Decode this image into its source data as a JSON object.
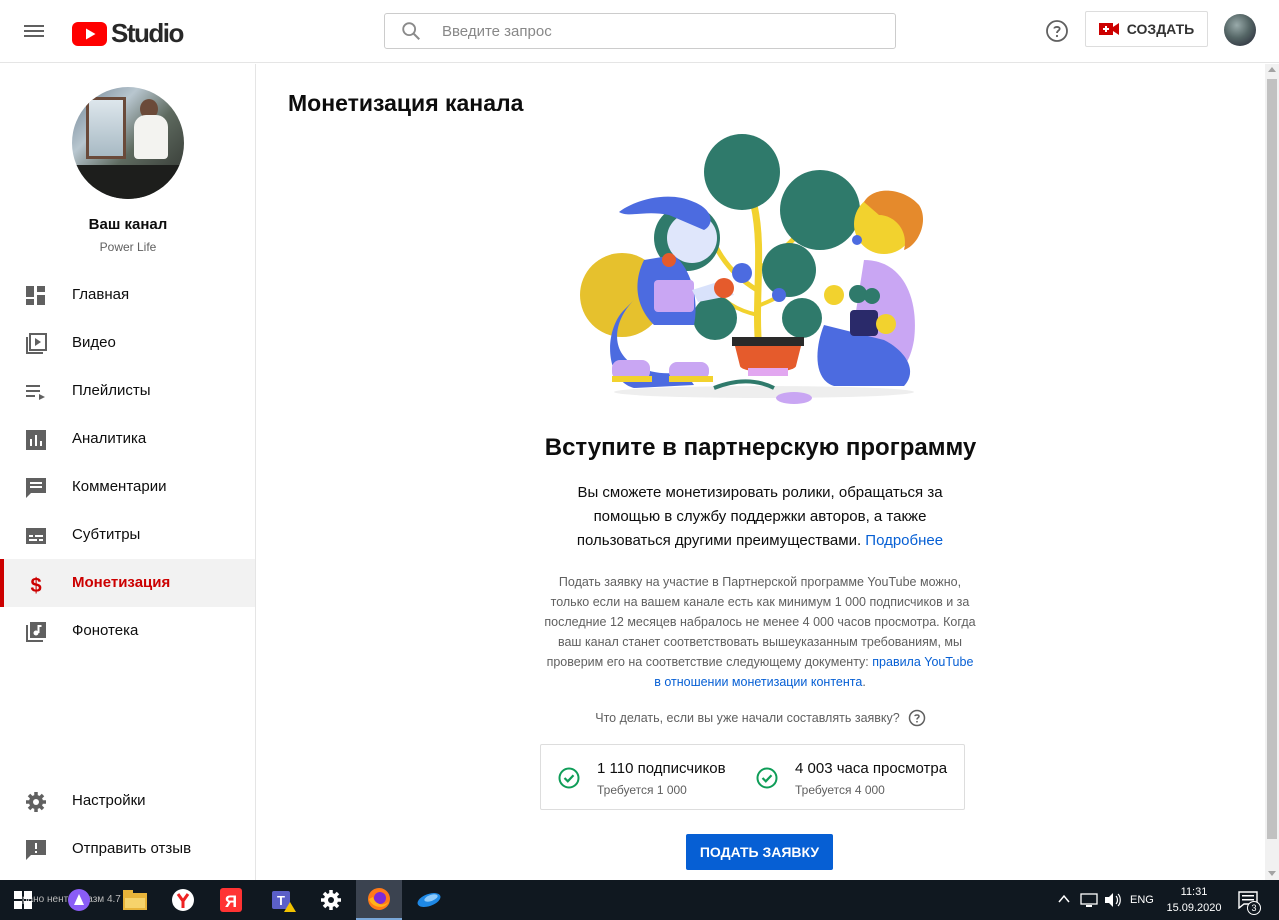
{
  "header": {
    "studio_label": "Studio",
    "search_placeholder": "Введите запрос",
    "create_label": "СОЗДАТЬ"
  },
  "sidebar": {
    "channel_name": "Ваш канал",
    "channel_handle": "Power Life",
    "items": [
      {
        "label": "Главная",
        "icon": "dashboard-icon"
      },
      {
        "label": "Видео",
        "icon": "video-library-icon"
      },
      {
        "label": "Плейлисты",
        "icon": "playlist-icon"
      },
      {
        "label": "Аналитика",
        "icon": "analytics-icon"
      },
      {
        "label": "Комментарии",
        "icon": "comment-icon"
      },
      {
        "label": "Субтитры",
        "icon": "subtitles-icon"
      },
      {
        "label": "Монетизация",
        "icon": "dollar-icon",
        "active": true
      },
      {
        "label": "Фонотека",
        "icon": "music-library-icon"
      }
    ],
    "bottom_items": [
      {
        "label": "Настройки",
        "icon": "settings-icon"
      },
      {
        "label": "Отправить отзыв",
        "icon": "feedback-icon"
      }
    ]
  },
  "main": {
    "page_title": "Монетизация канала",
    "heading": "Вступите в партнерскую программу",
    "intro_text": "Вы сможете монетизировать ролики, обращаться за помощью в службу поддержки авторов, а также пользоваться другими преимуществами.",
    "intro_link": "Подробнее",
    "requirements_text": "Подать заявку на участие в Партнерской программе YouTube можно, только если на вашем канале есть как минимум 1 000 подписчиков и за последние 12 месяцев набралось не менее 4 000 часов просмотра. Когда ваш канал станет соответствовать вышеуказанным требованиям, мы проверим его на соответствие следующему документу:",
    "requirements_link": "правила YouTube в отношении монетизации контента",
    "requirements_end": ".",
    "faq_text": "Что делать, если вы уже начали составлять заявку?",
    "stats": [
      {
        "value": "1 110 подписчиков",
        "required": "Требуется 1 000"
      },
      {
        "value": "4 003 часа просмотра",
        "required": "Требуется 4 000"
      }
    ],
    "apply_label": "ПОДАТЬ ЗАЯВКУ"
  },
  "taskbar": {
    "ghost_text": "рано   нентов   разм   4.7 К",
    "language": "ENG",
    "time": "11:31",
    "date": "15.09.2020",
    "notification_count": "3"
  },
  "colors": {
    "brand_red": "#ff0000",
    "active_red": "#cc0000",
    "link_blue": "#065fd4",
    "check_green": "#0f9d58"
  }
}
